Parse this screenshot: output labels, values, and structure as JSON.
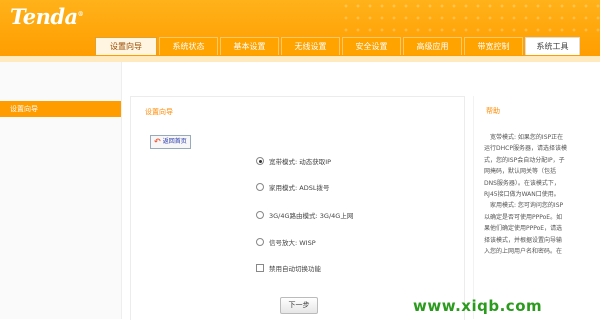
{
  "brand": {
    "logo": "Tenda",
    "trademark": "®"
  },
  "nav": {
    "tabs": [
      {
        "label": "设置向导",
        "active": true
      },
      {
        "label": "系统状态"
      },
      {
        "label": "基本设置"
      },
      {
        "label": "无线设置"
      },
      {
        "label": "安全设置"
      },
      {
        "label": "高级应用"
      },
      {
        "label": "带宽控制"
      },
      {
        "label": "系统工具"
      }
    ]
  },
  "sidebar": {
    "items": [
      {
        "label": "设置向导",
        "active": true
      }
    ]
  },
  "main": {
    "title": "设置向导",
    "back_label": "返回首页",
    "options": [
      {
        "label": "宽带模式: 动态获取IP",
        "type": "radio",
        "checked": true
      },
      {
        "label": "家用模式: ADSL拨号",
        "type": "radio"
      },
      {
        "label": "3G/4G路由模式: 3G/4G上网",
        "type": "radio"
      },
      {
        "label": "信号放大: WISP",
        "type": "radio"
      },
      {
        "label": "禁用自动切换功能",
        "type": "checkbox"
      }
    ],
    "next_label": "下一步"
  },
  "help": {
    "title": "帮助",
    "body": "　宽带模式: 如果您的ISP正在\n运行DHCP服务器，请选择该模\n式，您的ISP会自动分配IP，子\n网掩码，默认网关等（包括\nDNS服务器）。在该模式下，\nRJ45接口做为WAN口使用。\n　家用模式: 您可询问您的ISP\n以确定是否可使用PPPoE。如\n果他们确定使用PPPoE，请选\n择该模式，并根据设置向导输\n入您的上网用户名和密码。在"
  },
  "watermark": "www.xiqb.com",
  "colors": {
    "accent": "#ff9d00",
    "title": "#ff8a00",
    "watermark": "#2a9b1d"
  }
}
